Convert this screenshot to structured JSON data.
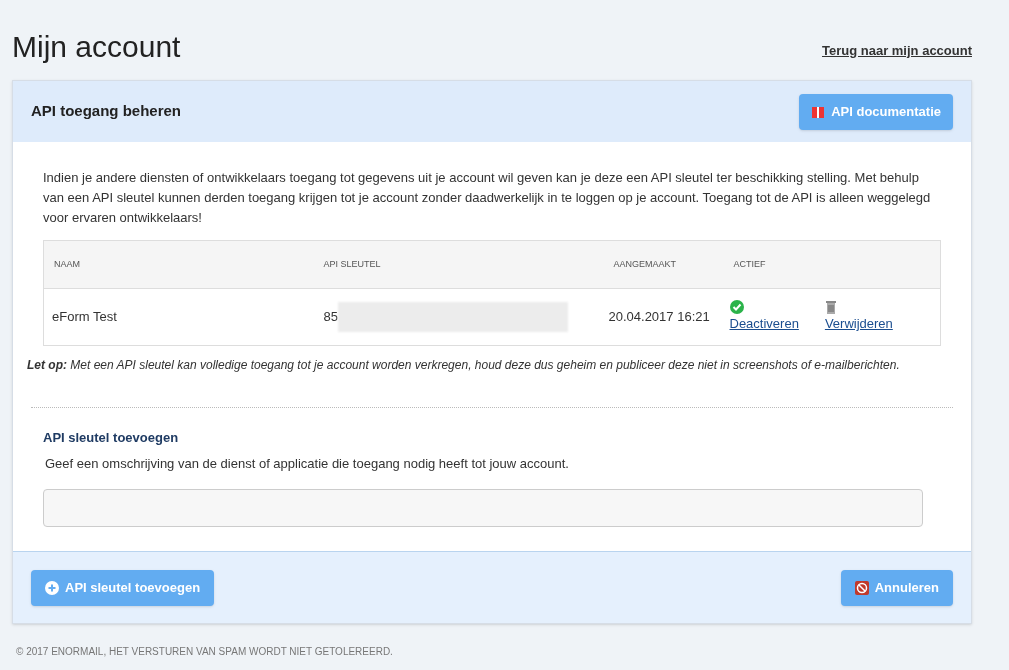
{
  "page_title": "Mijn account",
  "back_link": "Terug naar mijn account",
  "panel": {
    "title": "API toegang beheren",
    "doc_button": "API documentatie",
    "intro": "Indien je andere diensten of ontwikkelaars toegang tot gegevens uit je account wil geven kan je deze een API sleutel ter beschikking stelling. Met behulp van een API sleutel kunnen derden toegang krijgen tot je account zonder daadwerkelijk in te loggen op je account. Toegang tot de API is alleen weggelegd voor ervaren ontwikkelaars!",
    "table": {
      "columns": [
        "NAAM",
        "API SLEUTEL",
        "AANGEMAAKT",
        "ACTIEF"
      ],
      "rows": [
        {
          "name": "eForm Test",
          "key": "85",
          "created": "20.04.2017 16:21",
          "active": true,
          "toggle_link": "Deactiveren",
          "delete_link": "Verwijderen"
        }
      ]
    },
    "note": "**Let op:** Met een API sleutel kan volledige toegang tot je account worden verkregen, houd deze dus geheim en publiceer deze niet in screenshots of e-mailberichten.",
    "add_section": {
      "title": "API sleutel toevoegen",
      "hint": "Geef een omschrijving van de dienst of applicatie die toegang nodig heeft tot jouw account."
    },
    "add_button": "API sleutel toevoegen",
    "cancel_button": "Annuleren"
  },
  "footer": "© 2017 ENORMAIL, HET VERSTUREN VAN SPAM WORDT NIET GETOLEREERD."
}
